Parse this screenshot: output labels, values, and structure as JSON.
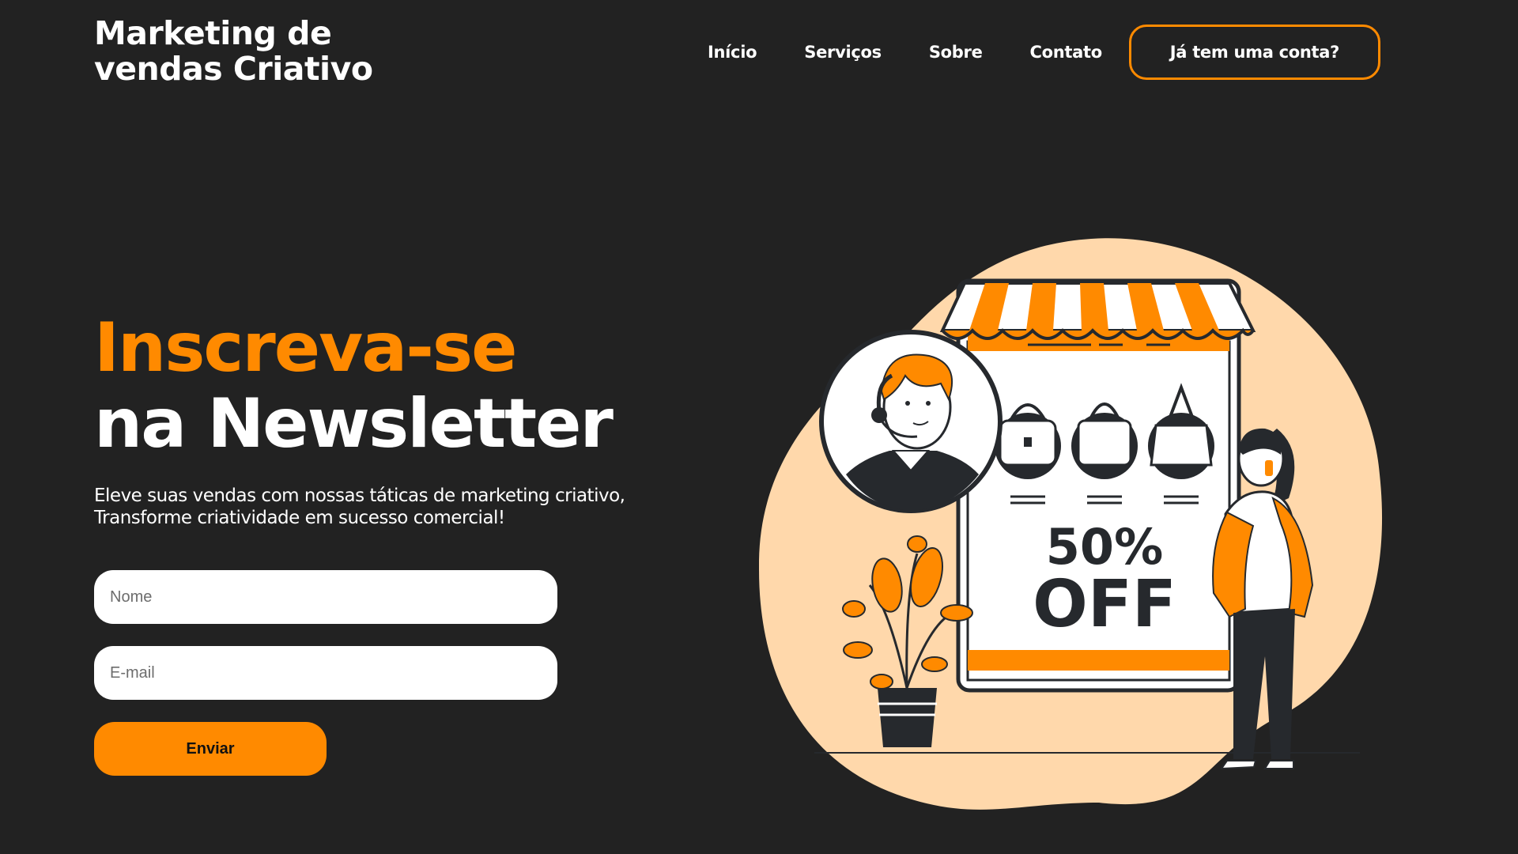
{
  "header": {
    "logo_line1": "Marketing de",
    "logo_line2": "vendas Criativo",
    "nav": {
      "inicio": "Início",
      "servicos": "Serviços",
      "sobre": "Sobre",
      "contato": "Contato"
    },
    "login_button": "Já tem uma conta?"
  },
  "hero": {
    "title_highlight": "Inscreva-se",
    "title_rest": "na Newsletter",
    "subtitle_line1": "Eleve suas vendas com nossas táticas de marketing criativo,",
    "subtitle_line2": "Transforme criatividade em sucesso comercial!"
  },
  "form": {
    "name_placeholder": "Nome",
    "email_placeholder": "E-mail",
    "submit_label": "Enviar"
  },
  "illustration": {
    "discount_percent": "50%",
    "discount_off": "OFF"
  },
  "colors": {
    "background": "#222222",
    "accent": "#ff8a00",
    "blob": "#ffd8ab",
    "ink": "#26292d"
  }
}
